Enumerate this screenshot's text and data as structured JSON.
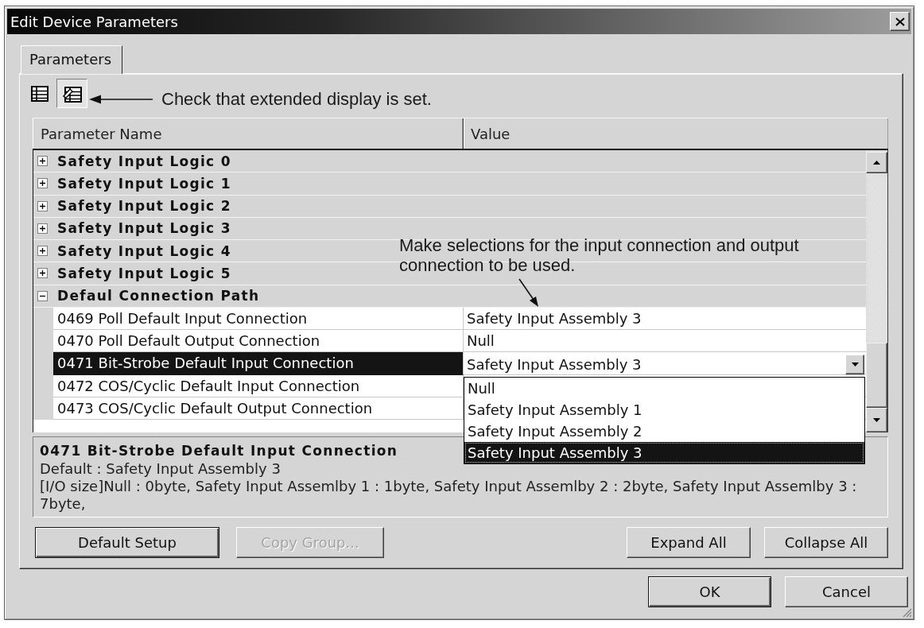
{
  "window": {
    "title": "Edit Device Parameters"
  },
  "tabs": [
    {
      "label": "Parameters",
      "selected": true
    }
  ],
  "toolbar": {
    "view_buttons": [
      {
        "kind": "list",
        "selected": false
      },
      {
        "kind": "extended",
        "selected": true
      }
    ],
    "note": "Check that extended display is set."
  },
  "table": {
    "columns": [
      "Parameter Name",
      "Value"
    ],
    "note": "Make selections for the input connection and output connection to be used.",
    "groups": [
      {
        "label": "Safety Input Logic 0",
        "expanded": false
      },
      {
        "label": "Safety Input Logic 1",
        "expanded": false
      },
      {
        "label": "Safety Input Logic 2",
        "expanded": false
      },
      {
        "label": "Safety Input Logic 3",
        "expanded": false
      },
      {
        "label": "Safety Input Logic 4",
        "expanded": false
      },
      {
        "label": "Safety Input Logic 5",
        "expanded": false
      },
      {
        "label": "Defaul Connection Path",
        "expanded": true,
        "children": [
          {
            "name": "0469 Poll Default Input Connection",
            "value": "Safety Input Assembly 3",
            "selected": false
          },
          {
            "name": "0470 Poll Default Output Connection",
            "value": "Null",
            "selected": false
          },
          {
            "name": "0471 Bit-Strobe Default Input Connection",
            "value": "Safety Input Assembly 3",
            "selected": true,
            "options": [
              {
                "label": "Null",
                "selected": false
              },
              {
                "label": "Safety Input Assembly 1",
                "selected": false
              },
              {
                "label": "Safety Input Assembly 2",
                "selected": false
              },
              {
                "label": "Safety Input Assembly 3",
                "selected": true
              }
            ]
          },
          {
            "name": "0472 COS/Cyclic Default Input Connection",
            "selected": false
          },
          {
            "name": "0473 COS/Cyclic Default Output Connection",
            "selected": false
          }
        ]
      }
    ]
  },
  "description": {
    "title": "0471 Bit-Strobe Default Input Connection",
    "lines": [
      "Default : Safety Input Assembly 3",
      "[I/O size]Null : 0byte, Safety Input Assemlby 1 : 1byte, Safety Input Assemlby 2 : 2byte, Safety Input Assemlby 3 : 7byte,"
    ]
  },
  "panel_buttons": {
    "left": [
      {
        "label": "Default Setup",
        "disabled": false,
        "default": true
      },
      {
        "label": "Copy Group...",
        "disabled": true,
        "default": false
      }
    ],
    "right": [
      {
        "label": "Expand All",
        "disabled": false,
        "default": false
      },
      {
        "label": "Collapse All",
        "disabled": false,
        "default": false
      }
    ]
  },
  "dialog_buttons": [
    {
      "label": "OK",
      "disabled": false,
      "default": true
    },
    {
      "label": "Cancel",
      "disabled": false,
      "default": false
    }
  ]
}
